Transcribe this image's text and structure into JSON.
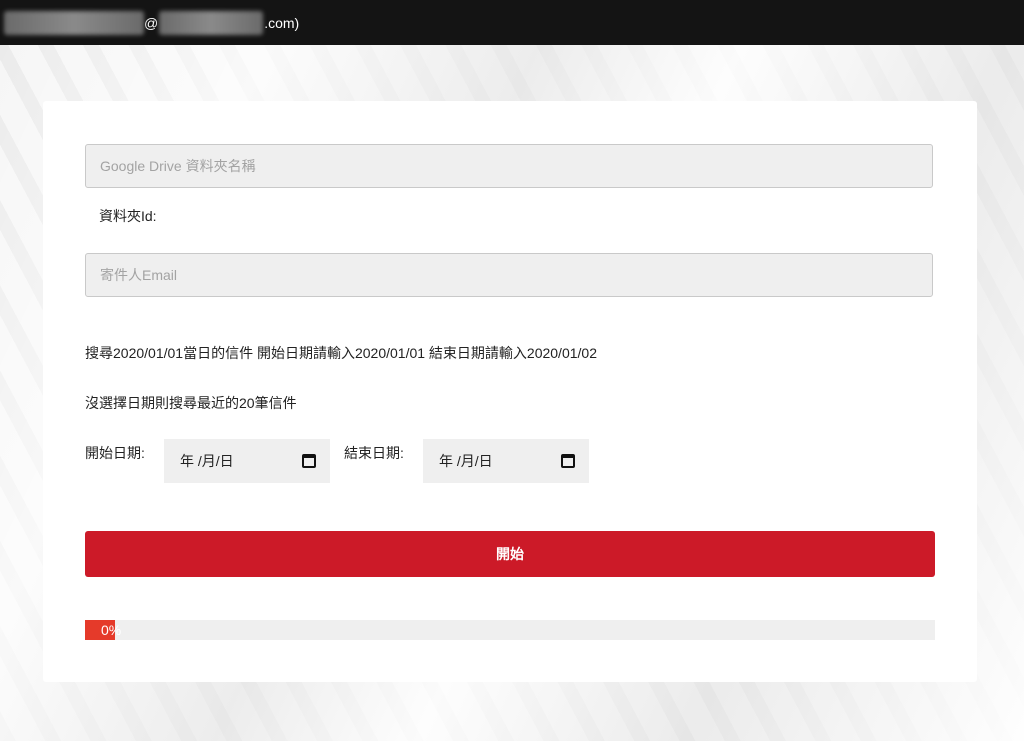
{
  "topbar": {
    "at_sign": "@",
    "domain_suffix": ".com)"
  },
  "form": {
    "folder_name_placeholder": "Google Drive 資料夾名稱",
    "folder_id_label": "資料夾Id:",
    "sender_email_placeholder": "寄件人Email",
    "hint_1": "搜尋2020/01/01當日的信件 開始日期請輸入2020/01/01 結束日期請輸入2020/01/02",
    "hint_2": "沒選擇日期則搜尋最近的20筆信件",
    "start_date_label": "開始日期:",
    "end_date_label": "結束日期:",
    "date_placeholder": "年 /月/日",
    "start_button_label": "開始"
  },
  "progress": {
    "value_percent": 0,
    "label": "0%"
  },
  "colors": {
    "accent": "#cc1a28",
    "progress": "#e53a2a",
    "topbar": "#141414"
  }
}
